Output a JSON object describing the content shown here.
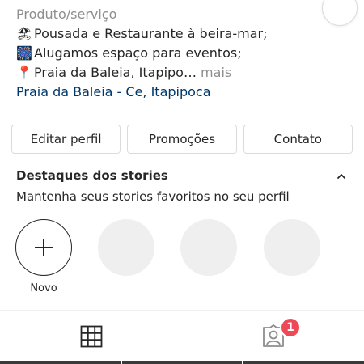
{
  "profile": {
    "category": "Produto/serviço",
    "bio_lines": [
      {
        "emoji": "🏖",
        "text": "Pousada e Restaurante à beira-mar;"
      },
      {
        "emoji": "🎆",
        "text": "Alugamos espaço para eventos;"
      },
      {
        "emoji": "📍",
        "text": "Praia da Baleia, Itapipo…",
        "more": " mais"
      }
    ],
    "location": "Praia da Baleia - Ce, Itapipoca"
  },
  "actions": {
    "edit_profile": "Editar perfil",
    "promotions": "Promoções",
    "contact": "Contato"
  },
  "highlights": {
    "title": "Destaques dos stories",
    "subtitle": "Mantenha seus stories favoritos no seu perfil",
    "new_label": "Novo"
  },
  "tabs": {
    "tagged_badge": "1"
  },
  "colors": {
    "link": "#00376b",
    "badge": "#ed4956",
    "muted": "#8e8e8e",
    "border": "#dbdbdb"
  }
}
